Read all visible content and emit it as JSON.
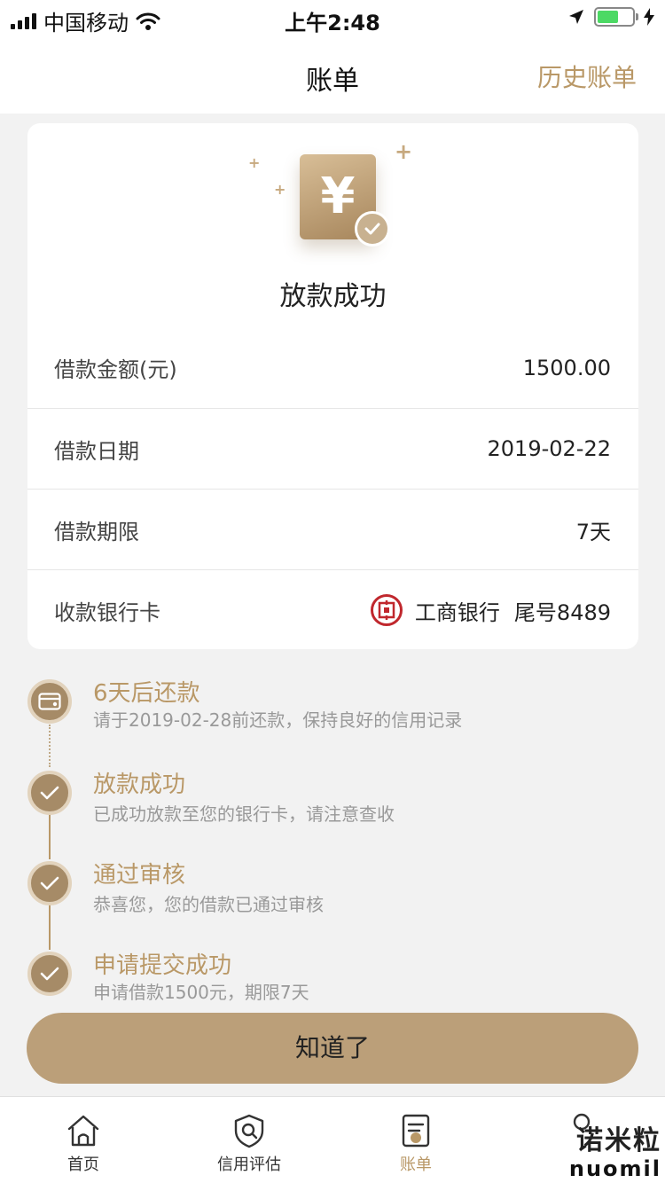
{
  "status_bar": {
    "carrier": "中国移动",
    "time": "上午2:48"
  },
  "nav": {
    "title": "账单",
    "history_label": "历史账单"
  },
  "loan_card": {
    "status_title": "放款成功",
    "yen_symbol": "¥",
    "rows": [
      {
        "label": "借款金额(元)",
        "value": "1500.00"
      },
      {
        "label": "借款日期",
        "value": "2019-02-22"
      },
      {
        "label": "借款期限",
        "value": "7天"
      },
      {
        "label": "收款银行卡",
        "bank_name": "工商银行",
        "card_tail": "尾号8489"
      }
    ]
  },
  "timeline": [
    {
      "title": "6天后还款",
      "desc": "请于2019-02-28前还款，保持良好的信用记录",
      "icon": "card-icon"
    },
    {
      "title": "放款成功",
      "desc": "已成功放款至您的银行卡，请注意查收",
      "icon": "check-icon"
    },
    {
      "title": "通过审核",
      "desc": "恭喜您，您的借款已通过审核",
      "icon": "check-icon"
    },
    {
      "title": "申请提交成功",
      "desc": "申请借款1500元，期限7天",
      "icon": "check-icon"
    }
  ],
  "confirm_button": "知道了",
  "tab_bar": {
    "items": [
      {
        "label": "首页",
        "icon": "home-icon"
      },
      {
        "label": "信用评估",
        "icon": "shield-search-icon"
      },
      {
        "label": "账单",
        "icon": "bill-icon",
        "active": true
      }
    ]
  },
  "watermark": {
    "cn": "诺米粒",
    "en": "nuomil"
  },
  "colors": {
    "accent": "#b99867",
    "button": "#bb9f79",
    "bank_red": "#c0272d"
  }
}
